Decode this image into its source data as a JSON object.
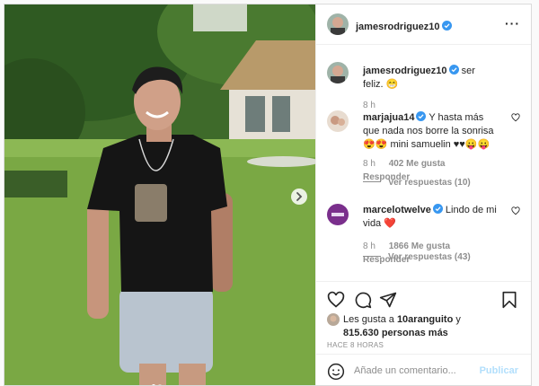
{
  "header": {
    "username": "jamesrodriguez10"
  },
  "caption": {
    "username": "jamesrodriguez10",
    "text": "ser feliz. 😁",
    "time": "8 h"
  },
  "comments": [
    {
      "username": "marjajua14",
      "text": "Y hasta más que nada nos borre la sonrisa 😍😍 mini samuelin ♥♥😛😛",
      "time": "8 h",
      "likes": "402 Me gusta",
      "reply_label": "Responder",
      "view_replies": "Ver respuestas (10)"
    },
    {
      "username": "marcelotwelve",
      "text": "Lindo de mi vida ❤️",
      "time": "8 h",
      "likes": "1866 Me gusta",
      "reply_label": "Responder",
      "view_replies": "Ver respuestas (43)"
    }
  ],
  "likes_summary": {
    "prefix": "Les gusta a ",
    "user": "10aranguito",
    "suffix": " y",
    "others": "815.630 personas más"
  },
  "time_ago": "HACE 8 HORAS",
  "add_comment": {
    "placeholder": "Añade un comentario...",
    "publish": "Publicar"
  },
  "colors": {
    "verified": "#3897f0",
    "publish_disabled": "#b2dffc",
    "heart_red": "#ed4956"
  }
}
